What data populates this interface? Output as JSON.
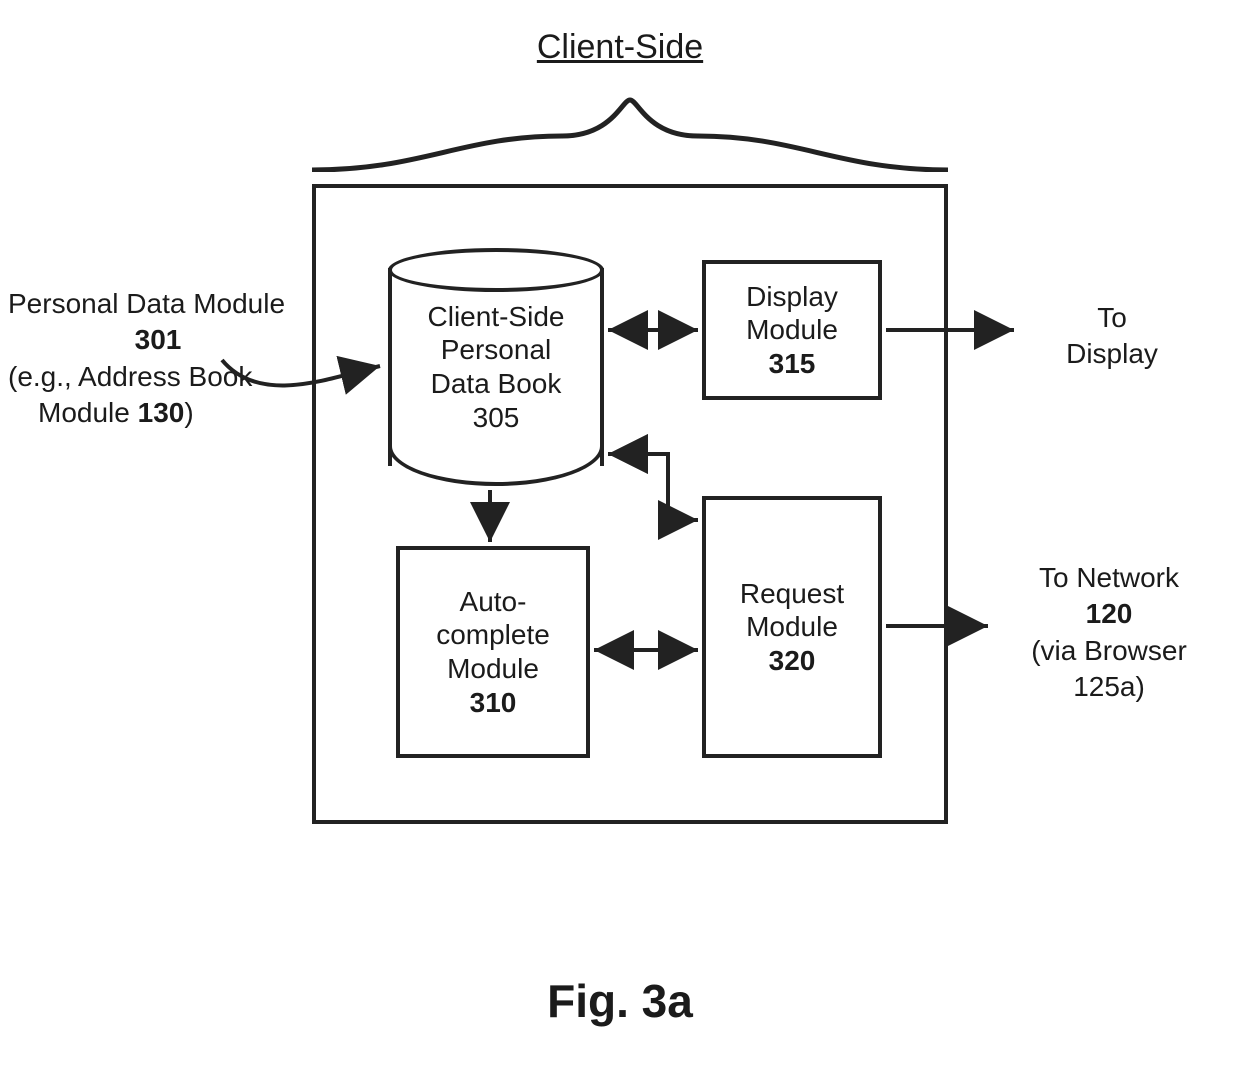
{
  "title": "Client-Side",
  "figure_caption": "Fig. 3a",
  "external_labels": {
    "personal_data_module": {
      "line1": "Personal Data Module",
      "num": "301",
      "line2a": "(e.g., Address Book",
      "line2b": "Module ",
      "num2": "130",
      "line2c": ")"
    },
    "to_display": {
      "line1": "To",
      "line2": "Display"
    },
    "to_network": {
      "line1": "To Network",
      "num": "120",
      "line2": "(via Browser",
      "line3": "125a)"
    }
  },
  "components": {
    "data_book": {
      "line1": "Client-Side",
      "line2": "Personal",
      "line3": "Data Book",
      "num": "305"
    },
    "display_module": {
      "line1": "Display",
      "line2": "Module",
      "num": "315"
    },
    "autocomplete_module": {
      "line1": "Auto-",
      "line2": "complete",
      "line3": "Module",
      "num": "310"
    },
    "request_module": {
      "line1": "Request",
      "line2": "Module",
      "num": "320"
    }
  },
  "connections": [
    {
      "from": "personal_data_module_label",
      "to": "data_book_305",
      "type": "pointer",
      "style": "curved-single"
    },
    {
      "from": "data_book_305",
      "to": "display_module_315",
      "type": "bidirectional"
    },
    {
      "from": "data_book_305",
      "to": "autocomplete_module_310",
      "type": "unidirectional"
    },
    {
      "from": "data_book_305",
      "to": "request_module_320",
      "type": "bidirectional",
      "routing": "elbow"
    },
    {
      "from": "autocomplete_module_310",
      "to": "request_module_320",
      "type": "bidirectional"
    },
    {
      "from": "display_module_315",
      "to": "To Display",
      "type": "unidirectional",
      "exits_container": true
    },
    {
      "from": "request_module_320",
      "to": "To Network 120",
      "type": "unidirectional",
      "exits_container": true
    }
  ]
}
